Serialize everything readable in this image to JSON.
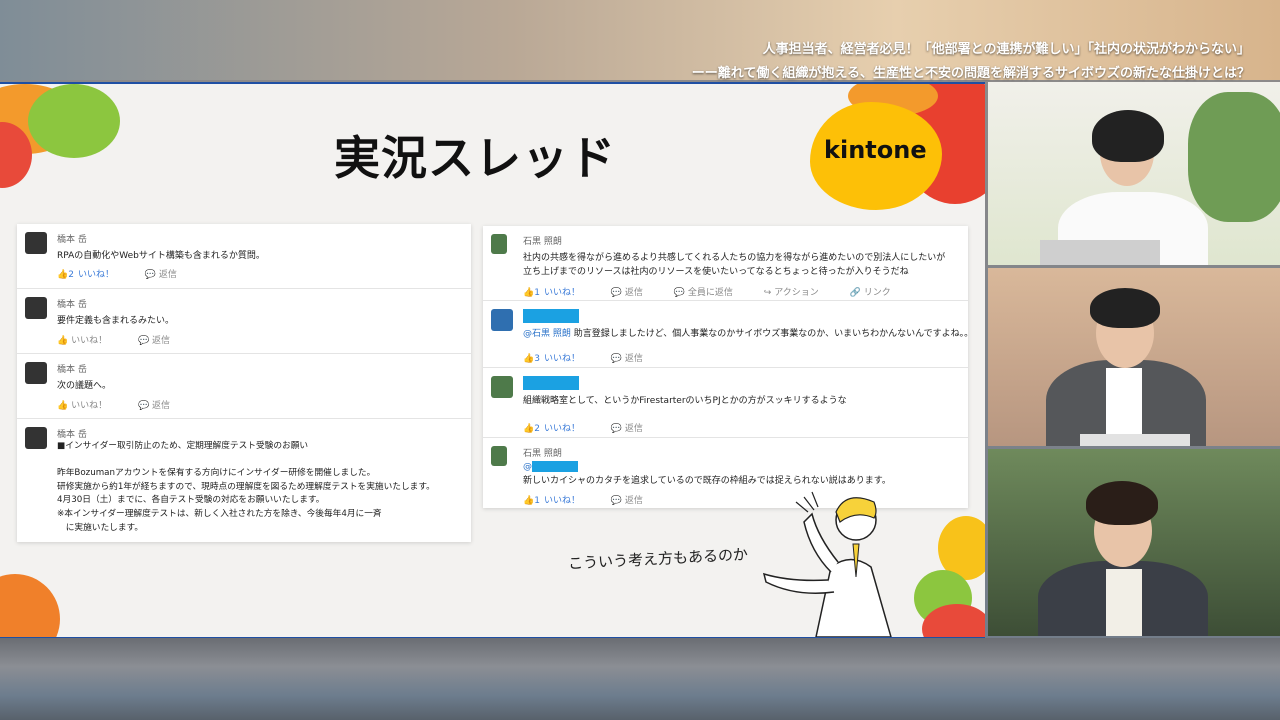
{
  "broadcast": {
    "headline_line1": "人事担当者、経営者必見！「他部署との連携が難しい」「社内の状況がわからない」",
    "headline_line2": "ーー離れて働く組織が抱える、生産性と不安の問題を解消するサイボウズの新たな仕掛けとは？"
  },
  "slide": {
    "title": "実況スレッド",
    "brand": "kintone",
    "caption": "こういう考え方もあるのか"
  },
  "left_thread": [
    {
      "author": "橋本 岳",
      "text": "RPAの自動化やWebサイト構築も含まれるか質問。",
      "like_count": "2",
      "like_label": "いいね！",
      "reply_label": "返信"
    },
    {
      "author": "橋本 岳",
      "text": "要件定義も含まれるみたい。",
      "like_label": "いいね！",
      "reply_label": "返信"
    },
    {
      "author": "橋本 岳",
      "text": "次の議題へ。",
      "like_label": "いいね！",
      "reply_label": "返信"
    },
    {
      "author": "橋本 岳",
      "text": "■インサイダー取引防止のため、定期理解度テスト受験のお願い\n\n昨年Bozumanアカウントを保有する方向けにインサイダー研修を開催しました。\n研修実施から約1年が経ちますので、現時点の理解度を図るため理解度テストを実施いたします。\n4月30日（土）までに、各自テスト受験の対応をお願いいたします。\n※本インサイダー理解度テストは、新しく入社された方を除き、今後毎年4月に一斉\n　に実施いたします。"
    }
  ],
  "right_thread": [
    {
      "author": "石黒 照朗",
      "text": "社内の共感を得ながら進めるより共感してくれる人たちの協力を得ながら進めたいので別法人にしたいが\n立ち上げまでのリソースは社内のリソースを使いたいってなるとちょっと待ったが入りそうだね",
      "like_count": "1",
      "like_label": "いいね！",
      "reply_label": "返信",
      "reply_all_label": "全員に返信",
      "action_label": "アクション",
      "link_label": "リンク"
    },
    {
      "mention": "@石黒 照朗",
      "text": " 助言登録しましたけど、個人事業なのかサイボウズ事業なのか、いまいちわかんないんですよね。。",
      "like_count": "3",
      "like_label": "いいね！",
      "reply_label": "返信"
    },
    {
      "text": "組織戦略室として、というかFirestarterのいちPJとかの方がスッキリするような",
      "like_count": "2",
      "like_label": "いいね！",
      "reply_label": "返信"
    },
    {
      "author": "石黒 照朗",
      "mention": "@",
      "text": "新しいカイシャのカタチを追求しているので既存の枠組みでは捉えられない説はあります。",
      "like_count": "1",
      "like_label": "いいね！",
      "reply_label": "返信"
    }
  ]
}
